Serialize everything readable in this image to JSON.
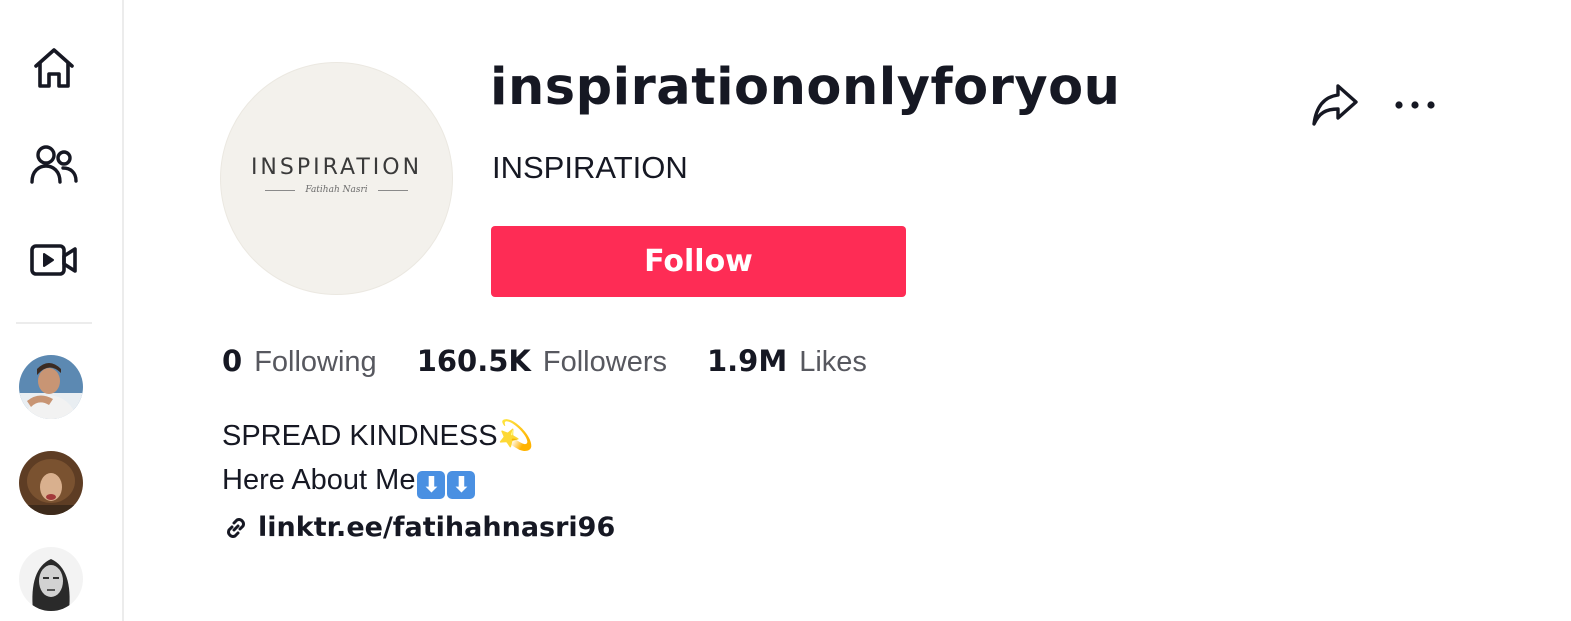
{
  "sidebar": {
    "nav": [
      {
        "icon": "home-icon"
      },
      {
        "icon": "following-icon"
      },
      {
        "icon": "live-icon"
      }
    ],
    "suggested_accounts": [
      {
        "icon": "avatar"
      },
      {
        "icon": "avatar"
      },
      {
        "icon": "avatar"
      }
    ]
  },
  "profile": {
    "avatar_brand": "INSPIRATION",
    "avatar_signature": "Fatihah Nasri",
    "username": "inspirationonlyforyou",
    "nickname": "INSPIRATION",
    "follow_label": "Follow",
    "share_icon": "share-icon",
    "more_icon": "more-icon"
  },
  "stats": {
    "following": {
      "count": "0",
      "label": "Following"
    },
    "followers": {
      "count": "160.5K",
      "label": "Followers"
    },
    "likes": {
      "count": "1.9M",
      "label": "Likes"
    }
  },
  "bio": {
    "line1": "SPREAD KINDNESS",
    "line1_emoji": "💫",
    "line2": "Here About Me",
    "line2_emoji": "⬇",
    "link_icon": "link-icon",
    "link": "linktr.ee/fatihahnasri96"
  },
  "colors": {
    "accent": "#fe2c55",
    "text": "#161823",
    "secondary_text": "#57585f"
  }
}
